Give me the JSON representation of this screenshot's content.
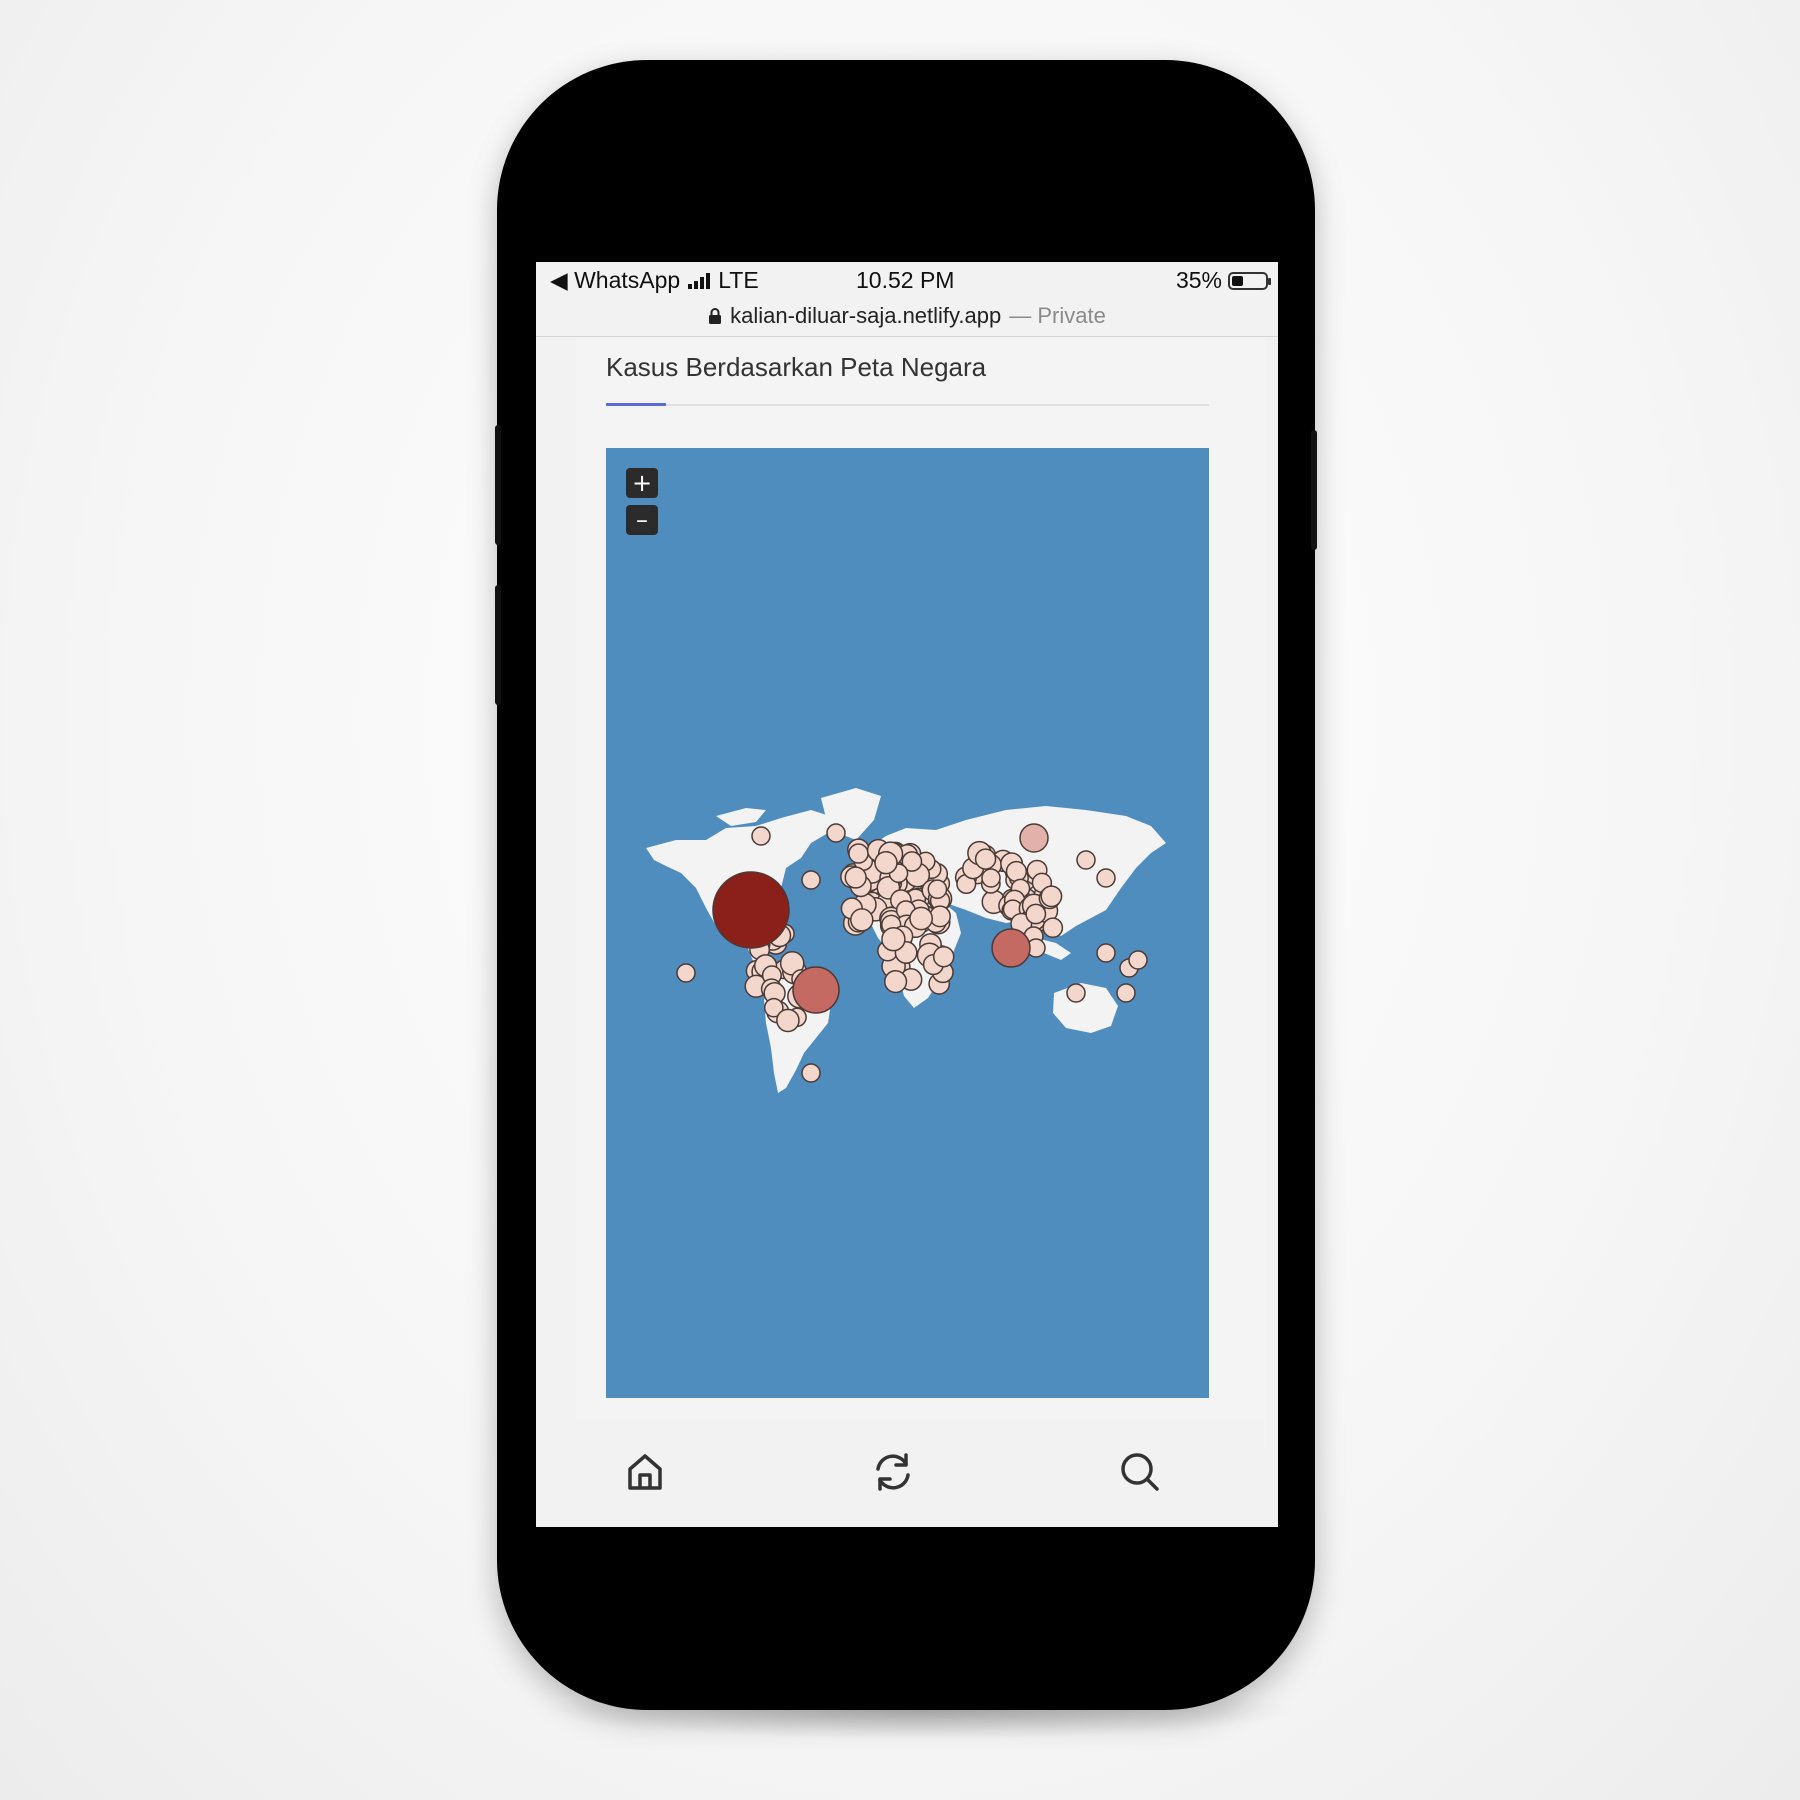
{
  "statusbar": {
    "back_app": "◀ WhatsApp",
    "network": "LTE",
    "time": "10.52 PM",
    "battery": "35%",
    "battery_level": 0.35
  },
  "browser": {
    "url": "kalian-diluar-saja.netlify.app",
    "mode": "— Private"
  },
  "card": {
    "title": "Kasus Berdasarkan Peta Negara"
  },
  "map": {
    "ocean_color": "#508dbf",
    "land_color": "#f3f3f3",
    "zoom_in_label": "+",
    "zoom_out_label": "–",
    "marker_colors": {
      "low": "#f3d6cc",
      "mid": "#c56a62",
      "high": "#8b1f1a"
    }
  },
  "bottom_nav": {
    "items": [
      {
        "icon": "home-icon"
      },
      {
        "icon": "refresh-icon"
      },
      {
        "icon": "search-icon"
      }
    ]
  }
}
